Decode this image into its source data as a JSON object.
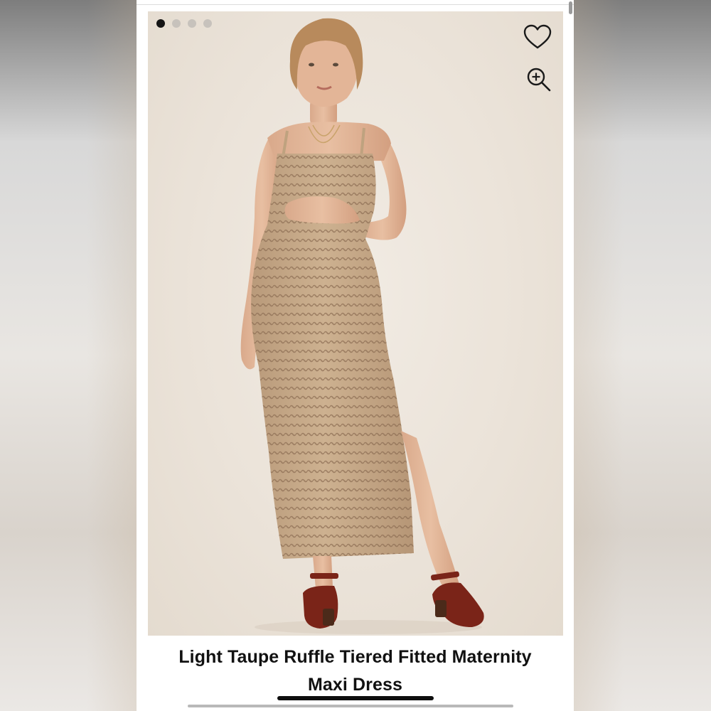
{
  "carousel": {
    "slide_count": 4,
    "active_index": 0
  },
  "icons": {
    "favorite": "heart-outline-icon",
    "zoom": "zoom-in-icon"
  },
  "product": {
    "title_line1": "Light Taupe Ruffle Tiered Fitted Maternity",
    "title_line2": "Maxi Dress"
  },
  "colors": {
    "photo_background": "#ebe3d9",
    "dress": "#c2a585",
    "sandals": "#7a2418",
    "active_dot": "#151515",
    "inactive_dot": "#c7c2bc"
  }
}
